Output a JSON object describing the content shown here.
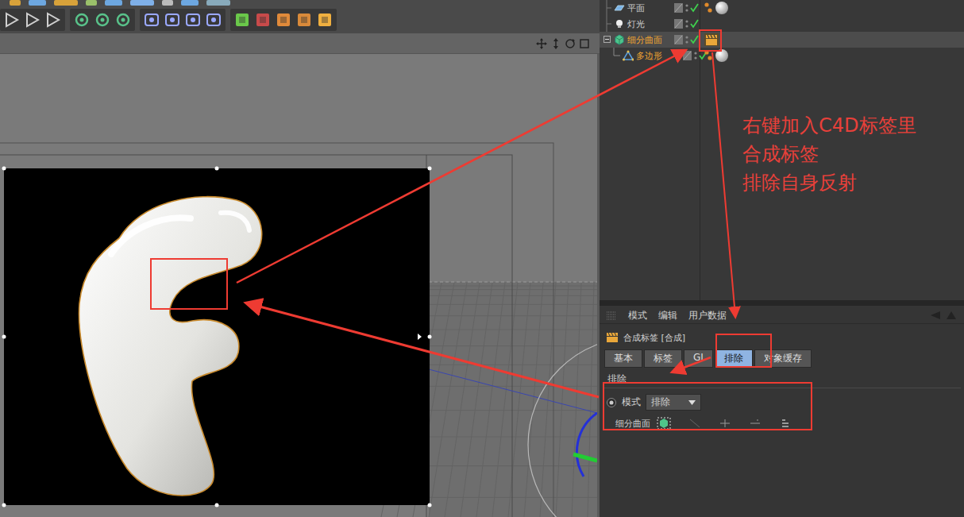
{
  "objects": [
    {
      "name": "平面",
      "kind": "plane",
      "selected": false,
      "highlighted": false,
      "expanded": false,
      "child": false,
      "tags": [
        {
          "kind": "material"
        }
      ]
    },
    {
      "name": "灯光",
      "kind": "light",
      "selected": false,
      "highlighted": false,
      "expanded": false,
      "child": false,
      "tags": []
    },
    {
      "name": "细分曲面",
      "kind": "subdivision",
      "selected": true,
      "highlighted": true,
      "expanded": true,
      "child": false,
      "tags": [
        {
          "kind": "composite"
        }
      ]
    },
    {
      "name": "多边形",
      "kind": "polygon",
      "selected": false,
      "highlighted": true,
      "expanded": false,
      "child": true,
      "tags": [
        {
          "kind": "material"
        }
      ]
    }
  ],
  "annotation": {
    "lines": [
      "右键加入C4D标签里",
      "合成标签",
      "排除自身反射"
    ]
  },
  "attributes": {
    "menu": [
      "模式",
      "编辑",
      "用户数据"
    ],
    "title": "合成标签 [合成]",
    "tabs": [
      {
        "label": "基本",
        "selected": false
      },
      {
        "label": "标签",
        "selected": false
      },
      {
        "label": "GI",
        "selected": false
      },
      {
        "label": "排除",
        "selected": true
      },
      {
        "label": "对象缓存",
        "selected": false
      }
    ],
    "section": "排除",
    "mode": {
      "label": "模式",
      "value": "排除",
      "selected": true
    },
    "items": [
      {
        "name": "细分曲面"
      }
    ]
  }
}
